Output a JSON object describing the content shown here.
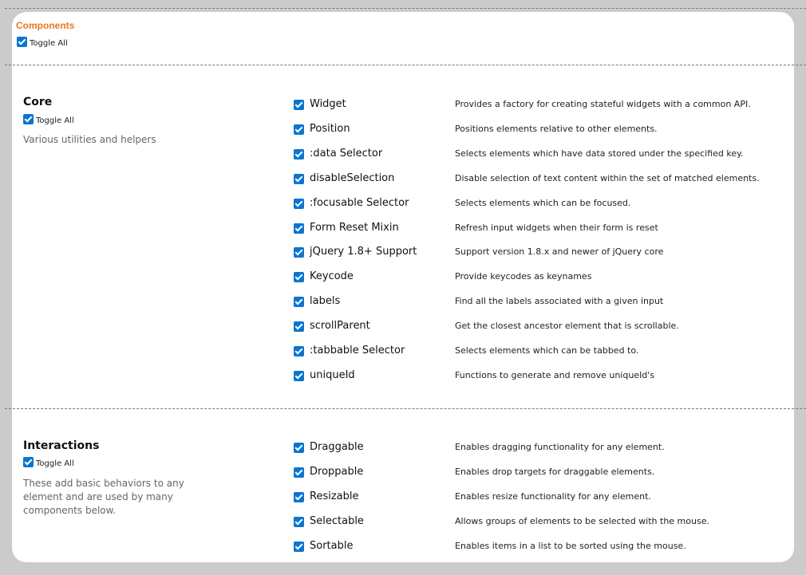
{
  "components": {
    "title": "Components",
    "toggle_all": "Toggle All"
  },
  "core": {
    "title": "Core",
    "toggle_all": "Toggle All",
    "description": "Various utilities and helpers",
    "items": [
      {
        "name": "Widget",
        "desc": "Provides a factory for creating stateful widgets with a common API.",
        "checked": true
      },
      {
        "name": "Position",
        "desc": "Positions elements relative to other elements.",
        "checked": true
      },
      {
        "name": ":data Selector",
        "desc": "Selects elements which have data stored under the specified key.",
        "checked": true
      },
      {
        "name": "disableSelection",
        "desc": "Disable selection of text content within the set of matched elements.",
        "checked": true
      },
      {
        "name": ":focusable Selector",
        "desc": "Selects elements which can be focused.",
        "checked": true
      },
      {
        "name": "Form Reset Mixin",
        "desc": "Refresh input widgets when their form is reset",
        "checked": true
      },
      {
        "name": "jQuery 1.8+ Support",
        "desc": "Support version 1.8.x and newer of jQuery core",
        "checked": true
      },
      {
        "name": "Keycode",
        "desc": "Provide keycodes as keynames",
        "checked": true
      },
      {
        "name": "labels",
        "desc": "Find all the labels associated with a given input",
        "checked": true
      },
      {
        "name": "scrollParent",
        "desc": "Get the closest ancestor element that is scrollable.",
        "checked": true
      },
      {
        "name": ":tabbable Selector",
        "desc": "Selects elements which can be tabbed to.",
        "checked": true
      },
      {
        "name": "uniqueId",
        "desc": "Functions to generate and remove uniqueId's",
        "checked": true
      }
    ]
  },
  "interactions": {
    "title": "Interactions",
    "toggle_all": "Toggle All",
    "description": "These add basic behaviors to any element and are used by many components below.",
    "items": [
      {
        "name": "Draggable",
        "desc": "Enables dragging functionality for any element.",
        "checked": true
      },
      {
        "name": "Droppable",
        "desc": "Enables drop targets for draggable elements.",
        "checked": true
      },
      {
        "name": "Resizable",
        "desc": "Enables resize functionality for any element.",
        "checked": true
      },
      {
        "name": "Selectable",
        "desc": "Allows groups of elements to be selected with the mouse.",
        "checked": true
      },
      {
        "name": "Sortable",
        "desc": "Enables items in a list to be sorted using the mouse.",
        "checked": true
      }
    ]
  },
  "colors": {
    "heading_accent": "#e87722",
    "checkbox": "#0b75d1"
  },
  "icons": {
    "checkbox": "checkbox-checked-icon"
  }
}
